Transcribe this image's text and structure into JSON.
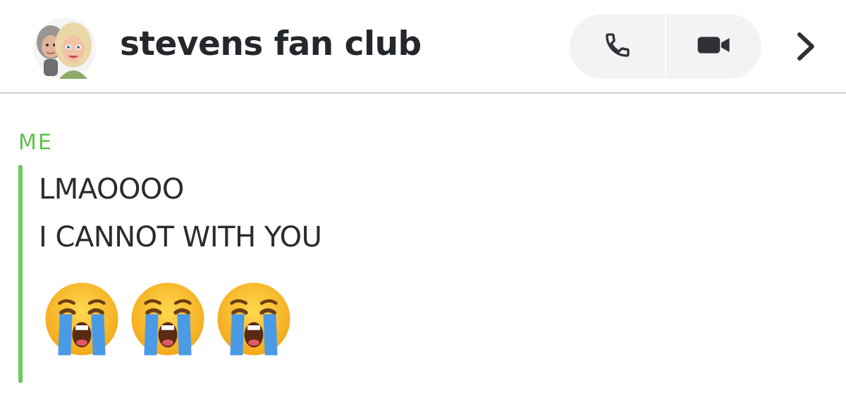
{
  "header": {
    "title": "stevens fan club",
    "avatar_icon": "group-bitmoji-avatar-icon",
    "buttons": {
      "voice_call_icon": "phone-icon",
      "video_call_icon": "video-camera-icon",
      "details_icon": "chevron-right-icon"
    }
  },
  "message": {
    "sender": "ME",
    "lines": [
      "LMAOOOO",
      "I CANNOT WITH YOU"
    ],
    "emoji": [
      "loudly-crying-face-icon",
      "loudly-crying-face-icon",
      "loudly-crying-face-icon"
    ]
  },
  "colors": {
    "sender_accent": "#5dc24a",
    "message_bar": "#6cc95a",
    "title_text": "#24272c",
    "call_button_bg": "#f2f3f5",
    "icon_gray": "#2f3136"
  }
}
